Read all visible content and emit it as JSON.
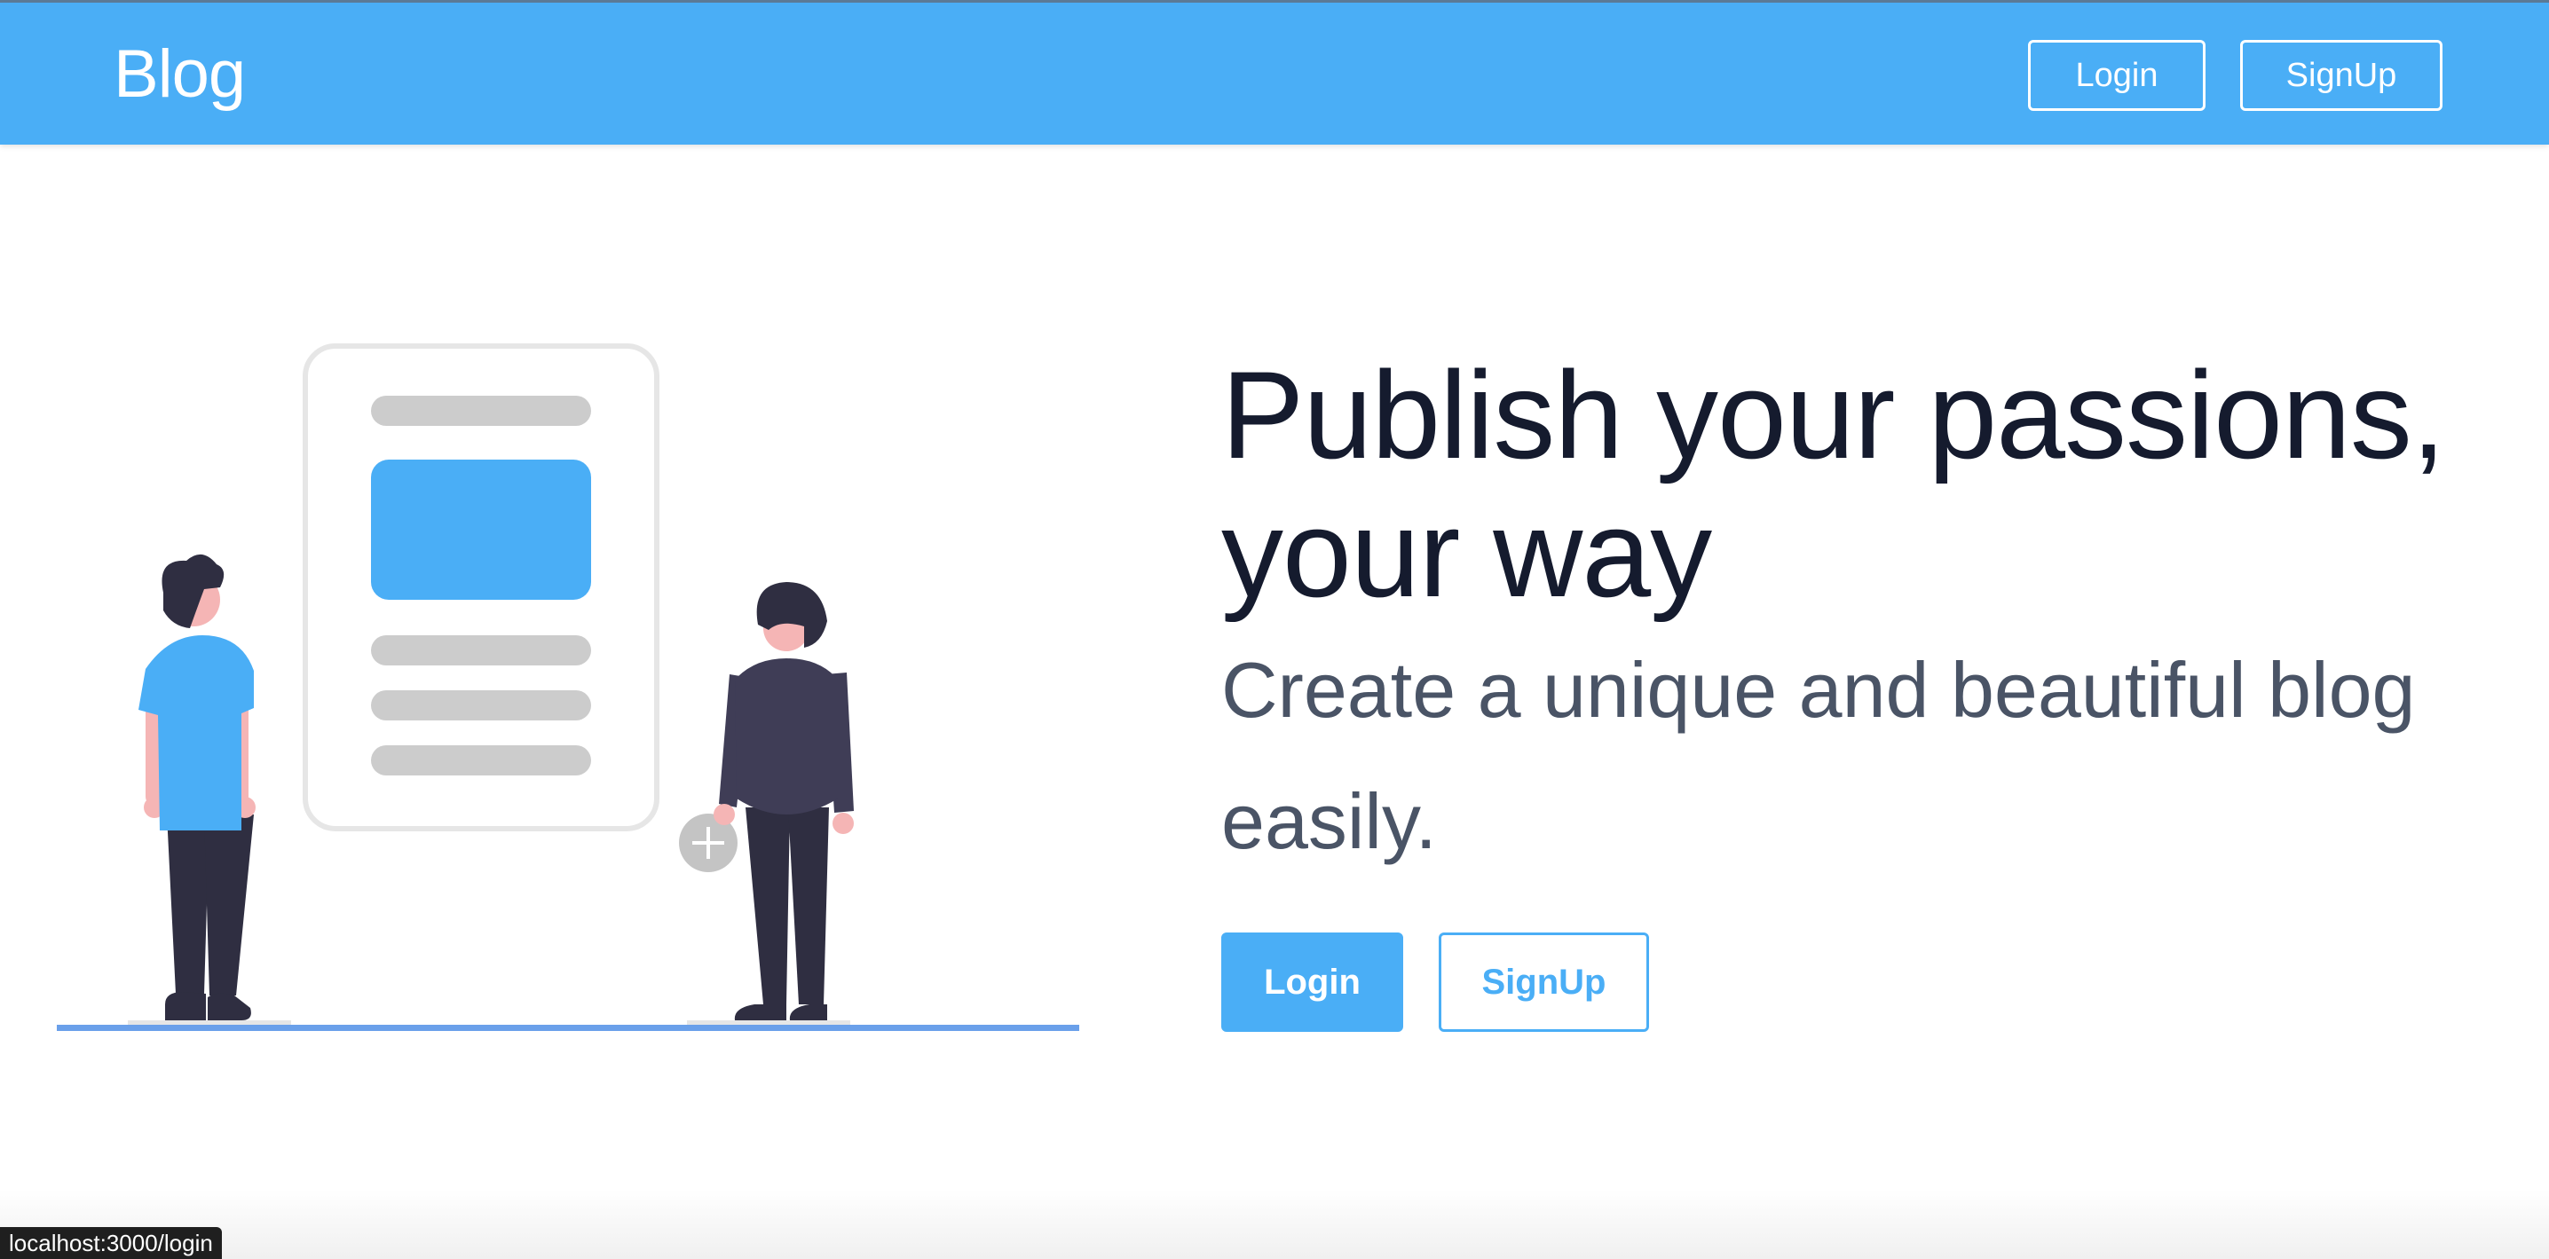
{
  "header": {
    "brand": "Blog",
    "login_label": "Login",
    "signup_label": "SignUp"
  },
  "hero": {
    "headline": "Publish your passions, your way",
    "subheadline": "Create a unique and beautiful blog easily.",
    "login_label": "Login",
    "signup_label": "SignUp"
  },
  "status": {
    "url": "localhost:3000/login"
  },
  "colors": {
    "primary": "#4aaef6",
    "heading": "#151b2e",
    "subheading": "#4a5466",
    "ground_line": "#6aa0ea"
  }
}
